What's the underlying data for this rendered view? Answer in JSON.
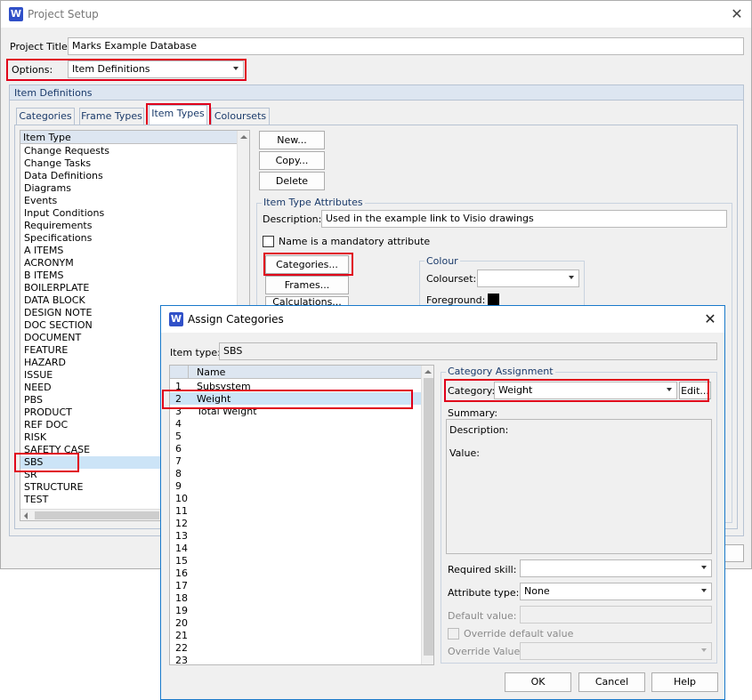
{
  "project_setup": {
    "title": "Project Setup",
    "app_icon_letter": "W",
    "project_title_label": "Project Title:",
    "project_title_value": "Marks Example Database",
    "options_label": "Options:",
    "options_value": "Item Definitions",
    "section_title": "Item Definitions",
    "tabs": [
      "Categories",
      "Frame Types",
      "Item Types",
      "Coloursets"
    ],
    "list_header": "Item Type",
    "item_types": [
      "Change Requests",
      "Change Tasks",
      "Data Definitions",
      "Diagrams",
      "Events",
      "Input Conditions",
      "Requirements",
      "Specifications",
      "A ITEMS",
      "ACRONYM",
      "B ITEMS",
      "BOILERPLATE",
      "DATA BLOCK",
      "DESIGN NOTE",
      "DOC SECTION",
      "DOCUMENT",
      "FEATURE",
      "HAZARD",
      "ISSUE",
      "NEED",
      "PBS",
      "PRODUCT",
      "REF DOC",
      "RISK",
      "SAFETY CASE",
      "SBS",
      "SR",
      "STRUCTURE",
      "TEST"
    ],
    "selected_item_type": "SBS",
    "buttons": {
      "new": "New...",
      "copy": "Copy...",
      "delete": "Delete"
    },
    "attributes_group": "Item Type Attributes",
    "description_label": "Description:",
    "description_value": "Used in the example link to Visio drawings",
    "mandatory_label": "Name is a mandatory attribute",
    "categories_button": "Categories...",
    "frames_button": "Frames...",
    "calculations_button": "Calculations...",
    "colour_group": "Colour",
    "colourset_label": "Colourset:",
    "colourset_value": "",
    "foreground_label": "Foreground:",
    "foreground_color": "#000000"
  },
  "assign_categories": {
    "title": "Assign Categories",
    "app_icon_letter": "W",
    "item_type_label": "Item type:",
    "item_type_value": "SBS",
    "name_header": "Name",
    "rows": [
      {
        "num": "1",
        "name": "Subsystem"
      },
      {
        "num": "2",
        "name": "Weight"
      },
      {
        "num": "3",
        "name": "Total Weight"
      },
      {
        "num": "4",
        "name": ""
      },
      {
        "num": "5",
        "name": ""
      },
      {
        "num": "6",
        "name": ""
      },
      {
        "num": "7",
        "name": ""
      },
      {
        "num": "8",
        "name": ""
      },
      {
        "num": "9",
        "name": ""
      },
      {
        "num": "10",
        "name": ""
      },
      {
        "num": "11",
        "name": ""
      },
      {
        "num": "12",
        "name": ""
      },
      {
        "num": "13",
        "name": ""
      },
      {
        "num": "14",
        "name": ""
      },
      {
        "num": "15",
        "name": ""
      },
      {
        "num": "16",
        "name": ""
      },
      {
        "num": "17",
        "name": ""
      },
      {
        "num": "18",
        "name": ""
      },
      {
        "num": "19",
        "name": ""
      },
      {
        "num": "20",
        "name": ""
      },
      {
        "num": "21",
        "name": ""
      },
      {
        "num": "22",
        "name": ""
      },
      {
        "num": "23",
        "name": ""
      }
    ],
    "selected_row": "2",
    "category_group": "Category Assignment",
    "category_label": "Category:",
    "category_value": "Weight",
    "edit_button": "Edit...",
    "summary_label": "Summary:",
    "summary_description": "Description:",
    "summary_value": "Value:",
    "required_skill_label": "Required skill:",
    "required_skill_value": "",
    "attribute_type_label": "Attribute type:",
    "attribute_type_value": "None",
    "default_value_label": "Default value:",
    "override_default_label": "Override default value",
    "override_value_label": "Override Value:",
    "ok": "OK",
    "cancel": "Cancel",
    "help": "Help"
  },
  "colors": {
    "highlight_red": "#e0001a",
    "selection": "#cce4f7",
    "dialog_border": "#1979ca"
  }
}
